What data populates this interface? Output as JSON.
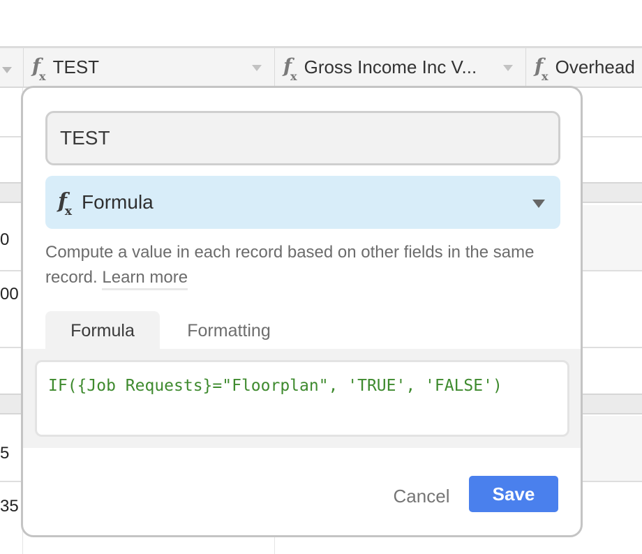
{
  "grid": {
    "columns": [
      {
        "name": "TEST",
        "type_icon": "formula-icon"
      },
      {
        "name": "Gross Income Inc V...",
        "type_icon": "formula-icon"
      },
      {
        "name": "Overhead",
        "type_icon": "formula-icon"
      }
    ],
    "partial_cell_values": [
      "0",
      "00",
      "5",
      "35"
    ]
  },
  "dialog": {
    "field_name": "TEST",
    "field_type": {
      "icon": "formula-icon",
      "label": "Formula"
    },
    "description": "Compute a value in each record based on other fields in the same record.",
    "learn_more": "Learn more",
    "tabs": [
      {
        "label": "Formula",
        "active": true
      },
      {
        "label": "Formatting",
        "active": false
      }
    ],
    "formula": "IF({Job Requests}=\"Floorplan\", 'TRUE', 'FALSE')",
    "cancel_label": "Cancel",
    "save_label": "Save",
    "colors": {
      "save_button": "#4a80ed",
      "type_select_bg": "#d8edf9",
      "formula_text": "#3e8a2e"
    }
  }
}
